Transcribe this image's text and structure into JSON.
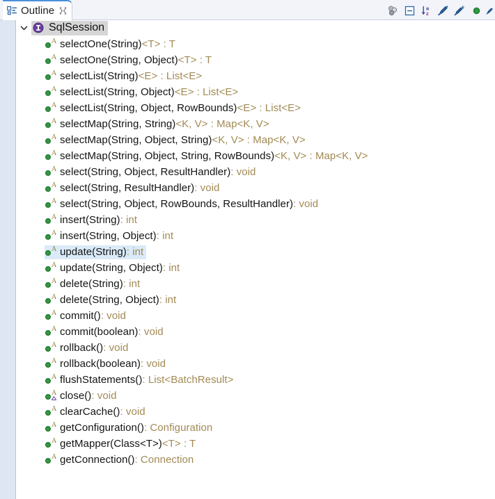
{
  "view": {
    "tab": {
      "label": "Outline",
      "icon": "outline-tree-icon",
      "close_icon": "close-icon"
    },
    "toolbar": {
      "buttons": [
        {
          "name": "group-members-icon",
          "tooltip": "Group Members"
        },
        {
          "name": "collapse-all-icon",
          "tooltip": "Collapse All"
        },
        {
          "name": "sort-alphabetically-icon",
          "tooltip": "Sort"
        },
        {
          "name": "hide-non-public-icon",
          "tooltip": "Hide Non-Public Members"
        },
        {
          "name": "hide-static-icon",
          "tooltip": "Hide Static Fields and Methods"
        },
        {
          "name": "hide-fields-icon",
          "tooltip": "Hide Fields"
        },
        {
          "name": "hide-local-types-icon",
          "tooltip": "Hide Local Types"
        }
      ]
    }
  },
  "tree": {
    "root": {
      "name": "SqlSession",
      "icon": "interface-icon",
      "expanded": true,
      "twisty_icon": "chevron-down-icon",
      "selected": true
    },
    "members": [
      {
        "name": "selectOne(String)",
        "ret": " <T> : T",
        "modifier": "abstract",
        "selected": false
      },
      {
        "name": "selectOne(String, Object)",
        "ret": " <T> : T",
        "modifier": "abstract",
        "selected": false
      },
      {
        "name": "selectList(String)",
        "ret": " <E> : List<E>",
        "modifier": "abstract",
        "selected": false
      },
      {
        "name": "selectList(String, Object)",
        "ret": " <E> : List<E>",
        "modifier": "abstract",
        "selected": false
      },
      {
        "name": "selectList(String, Object, RowBounds)",
        "ret": " <E> : List<E>",
        "modifier": "abstract",
        "selected": false
      },
      {
        "name": "selectMap(String, String)",
        "ret": " <K, V> : Map<K, V>",
        "modifier": "abstract",
        "selected": false
      },
      {
        "name": "selectMap(String, Object, String)",
        "ret": " <K, V> : Map<K, V>",
        "modifier": "abstract",
        "selected": false
      },
      {
        "name": "selectMap(String, Object, String, RowBounds)",
        "ret": " <K, V> : Map<K, V>",
        "modifier": "abstract",
        "selected": false
      },
      {
        "name": "select(String, Object, ResultHandler)",
        "ret": " : void",
        "modifier": "abstract",
        "selected": false
      },
      {
        "name": "select(String, ResultHandler)",
        "ret": " : void",
        "modifier": "abstract",
        "selected": false
      },
      {
        "name": "select(String, Object, RowBounds, ResultHandler)",
        "ret": " : void",
        "modifier": "abstract",
        "selected": false
      },
      {
        "name": "insert(String)",
        "ret": " : int",
        "modifier": "abstract",
        "selected": false
      },
      {
        "name": "insert(String, Object)",
        "ret": " : int",
        "modifier": "abstract",
        "selected": false
      },
      {
        "name": "update(String)",
        "ret": " : int",
        "modifier": "abstract",
        "selected": true
      },
      {
        "name": "update(String, Object)",
        "ret": " : int",
        "modifier": "abstract",
        "selected": false
      },
      {
        "name": "delete(String)",
        "ret": " : int",
        "modifier": "abstract",
        "selected": false
      },
      {
        "name": "delete(String, Object)",
        "ret": " : int",
        "modifier": "abstract",
        "selected": false
      },
      {
        "name": "commit()",
        "ret": " : void",
        "modifier": "abstract",
        "selected": false
      },
      {
        "name": "commit(boolean)",
        "ret": " : void",
        "modifier": "abstract",
        "selected": false
      },
      {
        "name": "rollback()",
        "ret": " : void",
        "modifier": "abstract",
        "selected": false
      },
      {
        "name": "rollback(boolean)",
        "ret": " : void",
        "modifier": "abstract",
        "selected": false
      },
      {
        "name": "flushStatements()",
        "ret": " : List<BatchResult>",
        "modifier": "abstract",
        "selected": false
      },
      {
        "name": "close()",
        "ret": " : void",
        "modifier": "abstract-override",
        "selected": false
      },
      {
        "name": "clearCache()",
        "ret": " : void",
        "modifier": "abstract",
        "selected": false
      },
      {
        "name": "getConfiguration()",
        "ret": " : Configuration",
        "modifier": "abstract",
        "selected": false
      },
      {
        "name": "getMapper(Class<T>)",
        "ret": " <T> : T",
        "modifier": "abstract",
        "selected": false
      },
      {
        "name": "getConnection()",
        "ret": " : Connection",
        "modifier": "abstract",
        "selected": false
      }
    ]
  },
  "colors": {
    "tab_active_border": "#4a90d9",
    "tab_bar_bg": "#f2f4f9",
    "gutter_bg": "#dee5f3",
    "selection_bg": "#daeaf8",
    "root_selection_bg": "#d6d6d6",
    "method_name": "#131313",
    "return_type": "#a28a54",
    "method_dot": "#2e9a3f",
    "interface_icon": "#6b3fa0"
  }
}
